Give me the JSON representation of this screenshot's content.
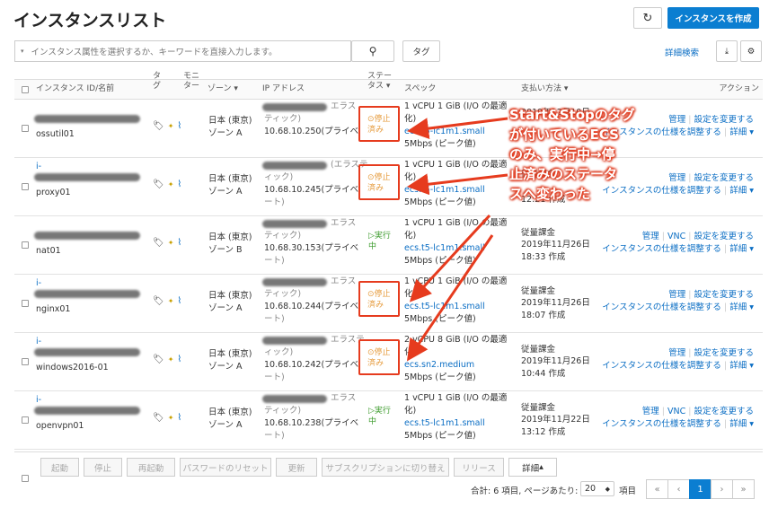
{
  "page": {
    "title": "インスタンスリスト",
    "create_button": "インスタンスを作成"
  },
  "toolbar": {
    "search_placeholder": "インスタンス属性を選択するか、キーワードを直接入力します。",
    "tag_button": "タグ",
    "advanced_search": "詳細検索"
  },
  "columns": {
    "id_name": "インスタンス ID/名前",
    "tag": "タグ",
    "monitor": "モニター",
    "zone": "ゾーン",
    "ip": "IP アドレス",
    "status": "ステータス",
    "spec": "スペック",
    "billing": "支払い方法",
    "action": "アクション"
  },
  "rows": [
    {
      "name": "ossutil01",
      "prefix": "",
      "zone1": "日本 (東京)",
      "zone2": "ゾーン A",
      "ip_type": "エラス",
      "ip2": "ティック)",
      "ip3": "10.68.10.250(プライベ",
      "ip4": "",
      "status": "停止済み",
      "s1": "停止",
      "s2": "済み",
      "spec1": "1 vCPU 1 GiB (I/O の最適",
      "spec2": "化)",
      "spec_link": "ecs.t5-lc1m1.small",
      "spec4": "5Mbps (ピーク値)",
      "bill1": "",
      "bill2": "2019年12月10日",
      "bill3": ""
    },
    {
      "name": "proxy01",
      "prefix": "i-",
      "zone1": "日本 (東京)",
      "zone2": "ゾーン A",
      "ip_type": "(エラステ",
      "ip2": "ィック)",
      "ip3": "10.68.10.245(プライベ",
      "ip4": "ート)",
      "status": "停止済み",
      "s1": "停止",
      "s2": "済み",
      "spec1": "1 vCPU 1 GiB (I/O の最適",
      "spec2": "化)",
      "spec_link": "ecs.t5-lc1m1.small",
      "spec4": "5Mbps (ピーク値)",
      "bill1": "従量課金",
      "bill2": "",
      "bill3": "12:21 作成"
    },
    {
      "name": "nat01",
      "prefix": "",
      "zone1": "日本 (東京)",
      "zone2": "ゾーン B",
      "ip_type": "エラス",
      "ip2": "ティック)",
      "ip3": "10.68.30.153(プライベ",
      "ip4": "ート)",
      "status": "実行中",
      "s1": "実行",
      "s2": "中",
      "spec1": "1 vCPU 1 GiB (I/O の最適",
      "spec2": "化)",
      "spec_link": "ecs.t5-lc1m1.small",
      "spec4": "5Mbps (ピーク値)",
      "bill1": "従量課金",
      "bill2": "2019年11月26日",
      "bill3": "18:33 作成"
    },
    {
      "name": "nginx01",
      "prefix": "i-",
      "zone1": "日本 (東京)",
      "zone2": "ゾーン A",
      "ip_type": "エラス",
      "ip2": "ティック)",
      "ip3": "10.68.10.244(プライベ",
      "ip4": "ート)",
      "status": "停止済み",
      "s1": "停止",
      "s2": "済み",
      "spec1": "1 vCPU 1 GiB (I/O の最適",
      "spec2": "化)",
      "spec_link": "ecs.t5-lc1m1.small",
      "spec4": "5Mbps (ピーク値)",
      "bill1": "従量課金",
      "bill2": "2019年11月26日",
      "bill3": "18:07 作成"
    },
    {
      "name": "windows2016-01",
      "prefix": "i-",
      "zone1": "日本 (東京)",
      "zone2": "ゾーン A",
      "ip_type": "エラステ",
      "ip2": "ィック)",
      "ip3": "10.68.10.242(プライベ",
      "ip4": "ート)",
      "status": "停止済み",
      "s1": "停止",
      "s2": "済み",
      "spec1": "2 vCPU 8 GiB (I/O の最適",
      "spec2": "化)",
      "spec_link": "ecs.sn2.medium",
      "spec4": "5Mbps (ピーク値)",
      "bill1": "従量課金",
      "bill2": "2019年11月26日",
      "bill3": "10:44 作成"
    },
    {
      "name": "openvpn01",
      "prefix": "i-",
      "zone1": "日本 (東京)",
      "zone2": "ゾーン A",
      "ip_type": "エラス",
      "ip2": "ティック)",
      "ip3": "10.68.10.238(プライベ",
      "ip4": "ート)",
      "status": "実行中",
      "s1": "実行",
      "s2": "中",
      "spec1": "1 vCPU 1 GiB (I/O の最適",
      "spec2": "化)",
      "spec_link": "ecs.t5-lc1m1.small",
      "spec4": "5Mbps (ピーク値)",
      "bill1": "従量課金",
      "bill2": "2019年11月22日",
      "bill3": "13:12 作成"
    }
  ],
  "actions": {
    "manage": "管理",
    "vnc": "VNC",
    "change": "設定を変更する",
    "adjust": "インスタンスの仕様を調整する",
    "more": "詳細"
  },
  "annotation": {
    "line1": "Start&Stopのタグ",
    "line2": "が付いているECS",
    "line3": "のみ、実行中→停",
    "line4": "止済みのステータ",
    "line5": "スへ変わった"
  },
  "footer": {
    "start": "起動",
    "stop": "停止",
    "restart": "再起動",
    "reset_pw": "パスワードのリセット",
    "renew": "更新",
    "switch_sub": "サブスクリプションに切り替え",
    "release": "リリース",
    "more": "詳細",
    "summary": "合計: 6 項目, ページあたり:",
    "page_size": "20",
    "items_label": "項目",
    "page": "1"
  }
}
